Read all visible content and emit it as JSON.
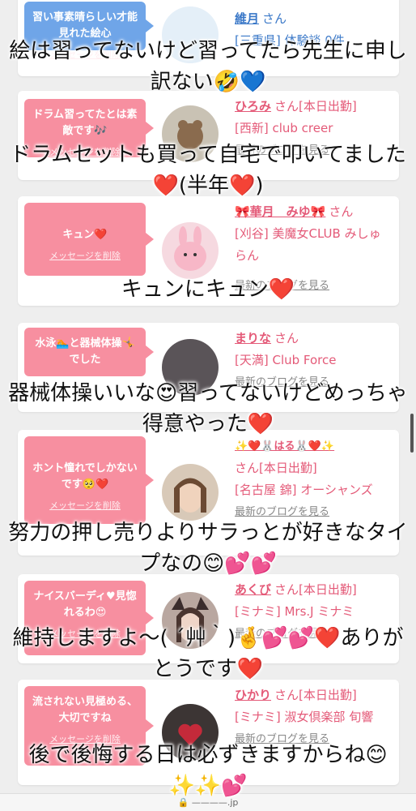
{
  "cards": [
    {
      "message": "習い事素晴らしい才能見れた絵心",
      "delete_label": "メッセージを削除",
      "name": "維月",
      "san": "さん",
      "shop": "[三重県] 体験談 0件",
      "blog": "",
      "theme": "blue"
    },
    {
      "message": "ドラム習ってたとは素敵です🎶",
      "delete_label": "メッセージを削除",
      "name": "ひろみ",
      "san": "さん[本日出勤]",
      "shop": "[西新] club creer",
      "blog": "最新のブログを見る",
      "theme": "pink"
    },
    {
      "message": "キュン❤️",
      "delete_label": "メッセージを削除",
      "name": "🎀華月　みゆ🎀",
      "san": "さん",
      "shop": "[刈谷] 美魔女CLUB みしゅらん",
      "blog": "最新のブログを見る",
      "theme": "pink"
    },
    {
      "message": "水泳🏊と器械体操🤸でした",
      "delete_label": "",
      "name": "まりな",
      "san": "さん",
      "shop": "[天満] Club Force",
      "blog": "最新のブログを見る",
      "theme": "pink"
    },
    {
      "message": "ホント憧れでしかないです🥺❤️",
      "delete_label": "メッセージを削除",
      "name": "✨❤️🐰はる🐰❤️✨",
      "san": "さん[本日出勤]",
      "shop": "[名古屋 錦] オーシャンズ",
      "blog": "最新のブログを見る",
      "theme": "pink"
    },
    {
      "message": "ナイスバーディ♥見惚れるわ😍",
      "delete_label": "メッセージを削除",
      "name": "あくび",
      "san": "さん[本日出勤]",
      "shop": "[ミナミ] Mrs.J ミナミ",
      "blog": "最新のブログを見る",
      "theme": "pink"
    },
    {
      "message": "流されない見極める、大切ですね",
      "delete_label": "メッセージを削除",
      "name": "ひかり",
      "san": "さん[本日出勤]",
      "shop": "[ミナミ] 淑女倶楽部 旬響",
      "blog": "最新のブログを見る",
      "theme": "pink"
    }
  ],
  "captions": [
    "絵は習ってないけど習ってたら先生に申し訳ない🤣💙",
    "ドラムセットも買って自宅で叩いてました❤️(半年❤️)",
    "キュンにキュン❤️",
    "器械体操いいな😍習ってないけどめっちゃ得意やった❤️",
    "努力の押し売りよりサラっとが好きなタイプなの😊💕💕",
    "維持しますよ〜( ´艸｀)🤞💕💕❤️ありがとうです❤️",
    "後で後悔する日は必ずきますからね😊✨✨💕"
  ],
  "footer": "🔒 ————.jp",
  "colors": {
    "pink": "#f78fa0",
    "blue": "#6fa5e8",
    "name_pink": "#e45a78",
    "name_blue": "#3a78c8"
  }
}
